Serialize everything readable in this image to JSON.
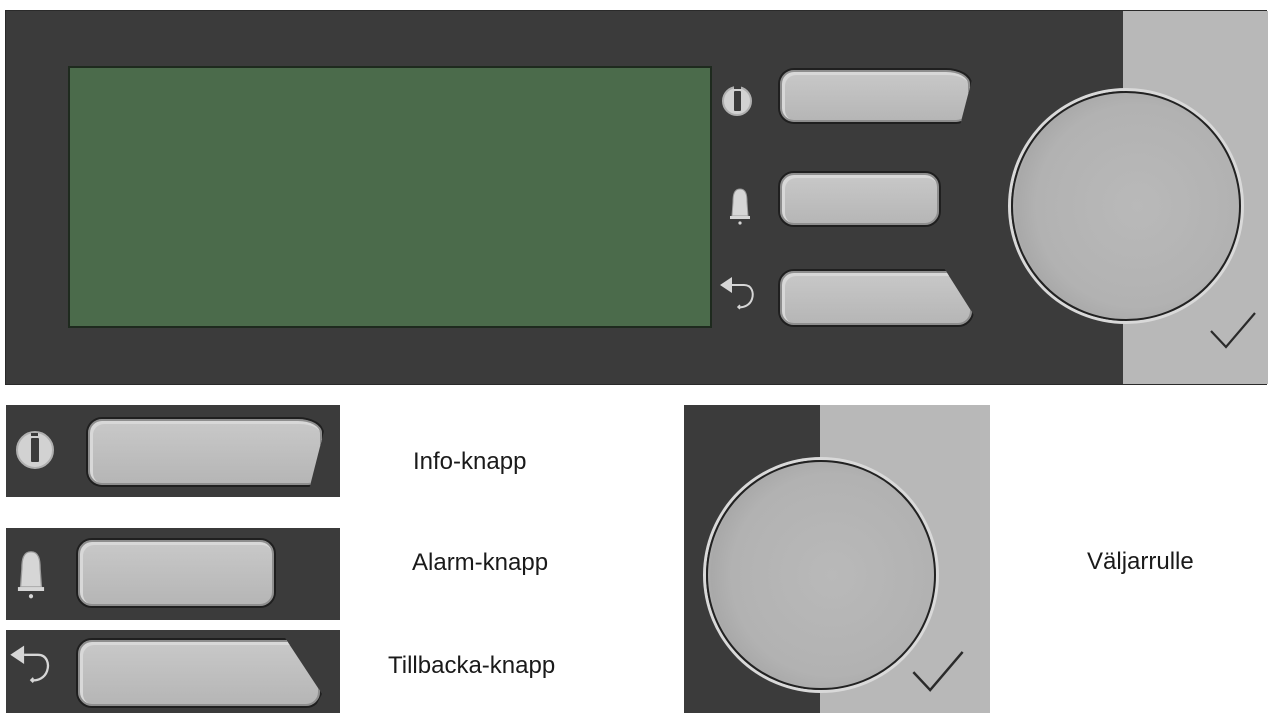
{
  "panel": {
    "buttons": [
      {
        "id": "info",
        "icon": "info-icon"
      },
      {
        "id": "alarm",
        "icon": "bell-icon"
      },
      {
        "id": "back",
        "icon": "back-arrow-icon"
      }
    ],
    "knob_icon": "selector-knob",
    "confirm_icon": "checkmark-icon"
  },
  "legend": {
    "info_label": "Info-knapp",
    "alarm_label": "Alarm-knapp",
    "back_label": "Tillbacka-knapp",
    "knob_label": "Väljarrulle"
  },
  "colors": {
    "panel_bg": "#3b3b3b",
    "display_bg": "#4b6b4b",
    "button_bg": "#bdbdbd",
    "right_area_bg": "#b8b8b8"
  }
}
